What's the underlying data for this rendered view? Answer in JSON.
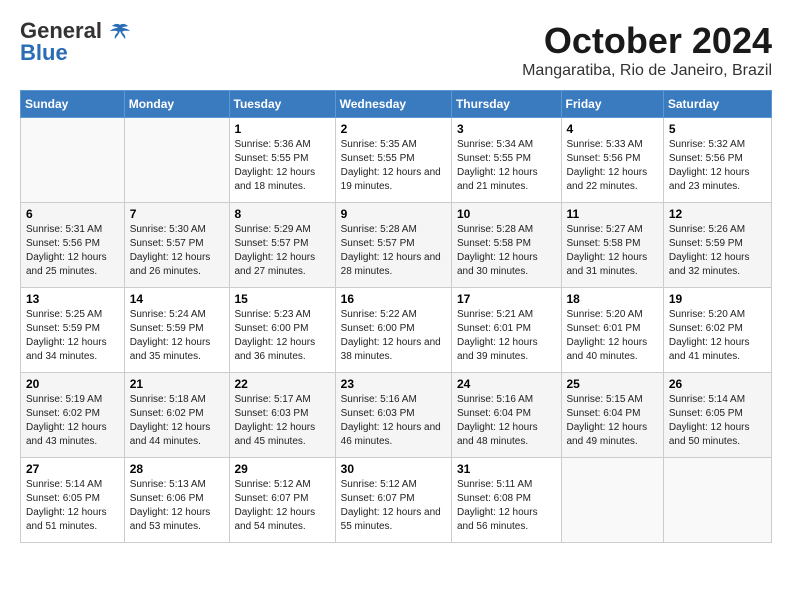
{
  "header": {
    "logo_line1": "General",
    "logo_line2": "Blue",
    "month_title": "October 2024",
    "location": "Mangaratiba, Rio de Janeiro, Brazil"
  },
  "weekdays": [
    "Sunday",
    "Monday",
    "Tuesday",
    "Wednesday",
    "Thursday",
    "Friday",
    "Saturday"
  ],
  "weeks": [
    [
      {
        "day": "",
        "sunrise": "",
        "sunset": "",
        "daylight": ""
      },
      {
        "day": "",
        "sunrise": "",
        "sunset": "",
        "daylight": ""
      },
      {
        "day": "1",
        "sunrise": "Sunrise: 5:36 AM",
        "sunset": "Sunset: 5:55 PM",
        "daylight": "Daylight: 12 hours and 18 minutes."
      },
      {
        "day": "2",
        "sunrise": "Sunrise: 5:35 AM",
        "sunset": "Sunset: 5:55 PM",
        "daylight": "Daylight: 12 hours and 19 minutes."
      },
      {
        "day": "3",
        "sunrise": "Sunrise: 5:34 AM",
        "sunset": "Sunset: 5:55 PM",
        "daylight": "Daylight: 12 hours and 21 minutes."
      },
      {
        "day": "4",
        "sunrise": "Sunrise: 5:33 AM",
        "sunset": "Sunset: 5:56 PM",
        "daylight": "Daylight: 12 hours and 22 minutes."
      },
      {
        "day": "5",
        "sunrise": "Sunrise: 5:32 AM",
        "sunset": "Sunset: 5:56 PM",
        "daylight": "Daylight: 12 hours and 23 minutes."
      }
    ],
    [
      {
        "day": "6",
        "sunrise": "Sunrise: 5:31 AM",
        "sunset": "Sunset: 5:56 PM",
        "daylight": "Daylight: 12 hours and 25 minutes."
      },
      {
        "day": "7",
        "sunrise": "Sunrise: 5:30 AM",
        "sunset": "Sunset: 5:57 PM",
        "daylight": "Daylight: 12 hours and 26 minutes."
      },
      {
        "day": "8",
        "sunrise": "Sunrise: 5:29 AM",
        "sunset": "Sunset: 5:57 PM",
        "daylight": "Daylight: 12 hours and 27 minutes."
      },
      {
        "day": "9",
        "sunrise": "Sunrise: 5:28 AM",
        "sunset": "Sunset: 5:57 PM",
        "daylight": "Daylight: 12 hours and 28 minutes."
      },
      {
        "day": "10",
        "sunrise": "Sunrise: 5:28 AM",
        "sunset": "Sunset: 5:58 PM",
        "daylight": "Daylight: 12 hours and 30 minutes."
      },
      {
        "day": "11",
        "sunrise": "Sunrise: 5:27 AM",
        "sunset": "Sunset: 5:58 PM",
        "daylight": "Daylight: 12 hours and 31 minutes."
      },
      {
        "day": "12",
        "sunrise": "Sunrise: 5:26 AM",
        "sunset": "Sunset: 5:59 PM",
        "daylight": "Daylight: 12 hours and 32 minutes."
      }
    ],
    [
      {
        "day": "13",
        "sunrise": "Sunrise: 5:25 AM",
        "sunset": "Sunset: 5:59 PM",
        "daylight": "Daylight: 12 hours and 34 minutes."
      },
      {
        "day": "14",
        "sunrise": "Sunrise: 5:24 AM",
        "sunset": "Sunset: 5:59 PM",
        "daylight": "Daylight: 12 hours and 35 minutes."
      },
      {
        "day": "15",
        "sunrise": "Sunrise: 5:23 AM",
        "sunset": "Sunset: 6:00 PM",
        "daylight": "Daylight: 12 hours and 36 minutes."
      },
      {
        "day": "16",
        "sunrise": "Sunrise: 5:22 AM",
        "sunset": "Sunset: 6:00 PM",
        "daylight": "Daylight: 12 hours and 38 minutes."
      },
      {
        "day": "17",
        "sunrise": "Sunrise: 5:21 AM",
        "sunset": "Sunset: 6:01 PM",
        "daylight": "Daylight: 12 hours and 39 minutes."
      },
      {
        "day": "18",
        "sunrise": "Sunrise: 5:20 AM",
        "sunset": "Sunset: 6:01 PM",
        "daylight": "Daylight: 12 hours and 40 minutes."
      },
      {
        "day": "19",
        "sunrise": "Sunrise: 5:20 AM",
        "sunset": "Sunset: 6:02 PM",
        "daylight": "Daylight: 12 hours and 41 minutes."
      }
    ],
    [
      {
        "day": "20",
        "sunrise": "Sunrise: 5:19 AM",
        "sunset": "Sunset: 6:02 PM",
        "daylight": "Daylight: 12 hours and 43 minutes."
      },
      {
        "day": "21",
        "sunrise": "Sunrise: 5:18 AM",
        "sunset": "Sunset: 6:02 PM",
        "daylight": "Daylight: 12 hours and 44 minutes."
      },
      {
        "day": "22",
        "sunrise": "Sunrise: 5:17 AM",
        "sunset": "Sunset: 6:03 PM",
        "daylight": "Daylight: 12 hours and 45 minutes."
      },
      {
        "day": "23",
        "sunrise": "Sunrise: 5:16 AM",
        "sunset": "Sunset: 6:03 PM",
        "daylight": "Daylight: 12 hours and 46 minutes."
      },
      {
        "day": "24",
        "sunrise": "Sunrise: 5:16 AM",
        "sunset": "Sunset: 6:04 PM",
        "daylight": "Daylight: 12 hours and 48 minutes."
      },
      {
        "day": "25",
        "sunrise": "Sunrise: 5:15 AM",
        "sunset": "Sunset: 6:04 PM",
        "daylight": "Daylight: 12 hours and 49 minutes."
      },
      {
        "day": "26",
        "sunrise": "Sunrise: 5:14 AM",
        "sunset": "Sunset: 6:05 PM",
        "daylight": "Daylight: 12 hours and 50 minutes."
      }
    ],
    [
      {
        "day": "27",
        "sunrise": "Sunrise: 5:14 AM",
        "sunset": "Sunset: 6:05 PM",
        "daylight": "Daylight: 12 hours and 51 minutes."
      },
      {
        "day": "28",
        "sunrise": "Sunrise: 5:13 AM",
        "sunset": "Sunset: 6:06 PM",
        "daylight": "Daylight: 12 hours and 53 minutes."
      },
      {
        "day": "29",
        "sunrise": "Sunrise: 5:12 AM",
        "sunset": "Sunset: 6:07 PM",
        "daylight": "Daylight: 12 hours and 54 minutes."
      },
      {
        "day": "30",
        "sunrise": "Sunrise: 5:12 AM",
        "sunset": "Sunset: 6:07 PM",
        "daylight": "Daylight: 12 hours and 55 minutes."
      },
      {
        "day": "31",
        "sunrise": "Sunrise: 5:11 AM",
        "sunset": "Sunset: 6:08 PM",
        "daylight": "Daylight: 12 hours and 56 minutes."
      },
      {
        "day": "",
        "sunrise": "",
        "sunset": "",
        "daylight": ""
      },
      {
        "day": "",
        "sunrise": "",
        "sunset": "",
        "daylight": ""
      }
    ]
  ]
}
